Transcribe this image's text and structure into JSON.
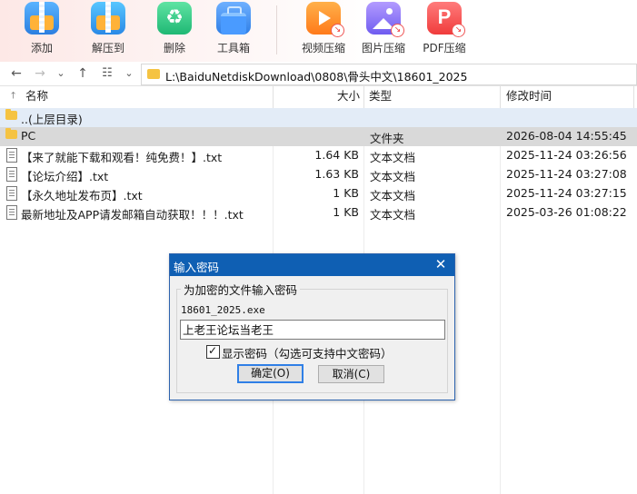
{
  "toolbar": {
    "tools": [
      {
        "label": "添加",
        "icon": "add-archive-icon"
      },
      {
        "label": "解压到",
        "icon": "extract-icon"
      },
      {
        "label": "删除",
        "icon": "recycle-icon"
      },
      {
        "label": "工具箱",
        "icon": "toolbox-icon"
      },
      {
        "label": "视频压缩",
        "icon": "video-compress-icon"
      },
      {
        "label": "图片压缩",
        "icon": "image-compress-icon"
      },
      {
        "label": "PDF压缩",
        "icon": "pdf-compress-icon"
      }
    ]
  },
  "address": {
    "path": "L:\\BaiduNetdiskDownload\\0808\\骨头中文\\18601_2025"
  },
  "list": {
    "columns": {
      "name": "名称",
      "size": "大小",
      "type": "类型",
      "modified": "修改时间"
    },
    "rows": [
      {
        "name": "..(上层目录)",
        "size": "",
        "type": "",
        "modified": "",
        "kind": "up"
      },
      {
        "name": "PC",
        "size": "",
        "type": "文件夹",
        "modified": "2026-08-04 14:55:45",
        "kind": "folder"
      },
      {
        "name": "【来了就能下载和观看！纯免费！】.txt",
        "size": "1.64 KB",
        "type": "文本文档",
        "modified": "2025-11-24 03:26:56",
        "kind": "text"
      },
      {
        "name": "【论坛介绍】.txt",
        "size": "1.63 KB",
        "type": "文本文档",
        "modified": "2025-11-24 03:27:08",
        "kind": "text"
      },
      {
        "name": "【永久地址发布页】.txt",
        "size": "1 KB",
        "type": "文本文档",
        "modified": "2025-11-24 03:27:15",
        "kind": "text"
      },
      {
        "name": "最新地址及APP请发邮箱自动获取！！！.txt",
        "size": "1 KB",
        "type": "文本文档",
        "modified": "2025-03-26 01:08:22",
        "kind": "text"
      }
    ]
  },
  "dialog": {
    "title": "输入密码",
    "group_label": "为加密的文件输入密码",
    "filename": "18601_2025.exe",
    "password_value": "上老王论坛当老王",
    "show_password_label": "显示密码（勾选可支持中文密码）",
    "show_password_checked": true,
    "ok_label": "确定(O)",
    "cancel_label": "取消(C)"
  },
  "colors": {
    "dialog_title_bg": "#0f5fb3",
    "selected_row": "#d9d9d9",
    "parent_row": "#e3ecf7"
  }
}
